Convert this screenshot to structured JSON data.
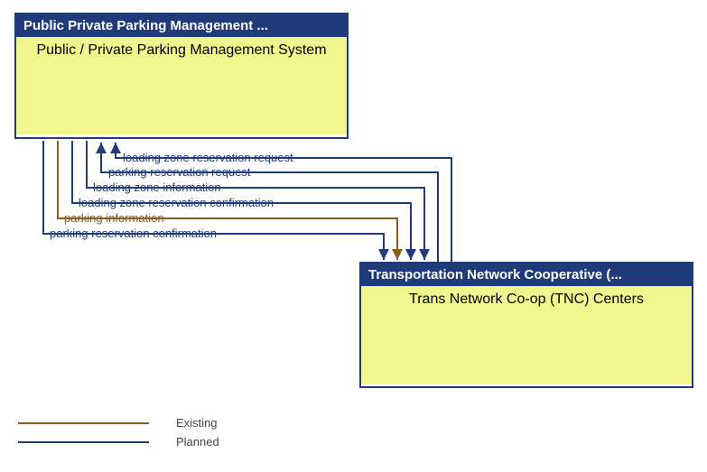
{
  "boxes": {
    "top": {
      "header": "Public Private Parking Management ...",
      "body": "Public / Private Parking Management System"
    },
    "bottom": {
      "header": "Transportation Network Cooperative (...",
      "body": "Trans Network Co-op (TNC) Centers"
    }
  },
  "flows": [
    {
      "label": "loading zone reservation request",
      "direction": "to_top",
      "status": "planned"
    },
    {
      "label": "parking reservation request",
      "direction": "to_top",
      "status": "planned"
    },
    {
      "label": "loading zone information",
      "direction": "to_bottom",
      "status": "planned"
    },
    {
      "label": "loading zone reservation confirmation",
      "direction": "to_bottom",
      "status": "planned"
    },
    {
      "label": "parking information",
      "direction": "to_bottom",
      "status": "existing"
    },
    {
      "label": "parking reservation confirmation",
      "direction": "to_bottom",
      "status": "planned"
    }
  ],
  "legend": {
    "existing": "Existing",
    "planned": "Planned"
  },
  "colors": {
    "planned": "#1f3b7a",
    "existing": "#8a5a1e",
    "box_fill": "#f0f58e"
  }
}
